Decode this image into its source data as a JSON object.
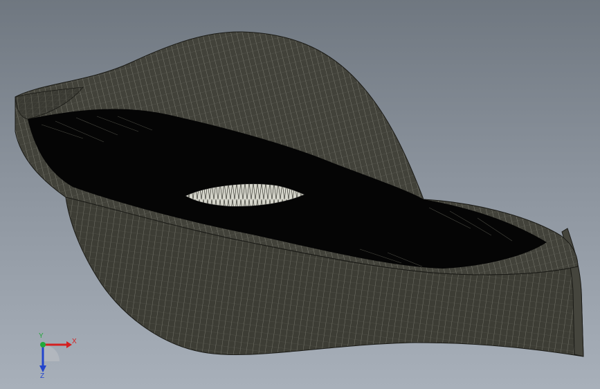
{
  "viewport": {
    "background_top": "#6f7780",
    "background_bottom": "#a8b0ba",
    "model": {
      "description_icon": "wireframe-shell-icon",
      "body_color": "#3e3e36",
      "mesh_color": "#d8d8cc",
      "opening_color": "#d6d6cc"
    }
  },
  "triad": {
    "x_label": "X",
    "y_label": "Y",
    "z_label": "Z",
    "x_color": "#d42020",
    "y_color": "#22a83a",
    "z_color": "#2244cc"
  }
}
